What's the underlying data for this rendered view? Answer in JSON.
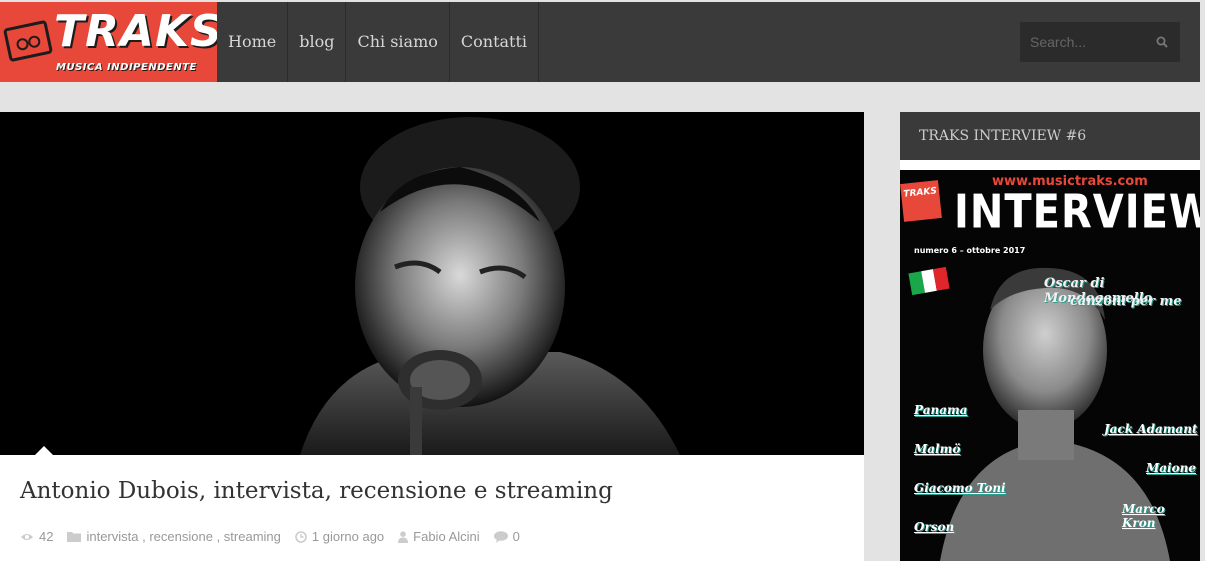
{
  "brand": {
    "name": "TRAKS",
    "tagline": "MUSICA INDIPENDENTE",
    "color": "#e8483a"
  },
  "nav": {
    "items": [
      {
        "label": "Home"
      },
      {
        "label": "blog"
      },
      {
        "label": "Chi siamo"
      },
      {
        "label": "Contatti"
      }
    ]
  },
  "search": {
    "placeholder": "Search..."
  },
  "post": {
    "title": "Antonio Dubois, intervista, recensione e streaming",
    "views": "42",
    "tags": [
      "intervista",
      "recensione",
      "streaming"
    ],
    "tag_sep": " , ",
    "date": "1 giorno ago",
    "author": "Fabio Alcini",
    "comments": "0"
  },
  "sidebar": {
    "widget_title": "TRAKS INTERVIEW #6",
    "magazine": {
      "url": "www.musictraks.com",
      "logo": "TRAKS",
      "headline": "INTERVIEW",
      "issue": "numero 6 – ottobre 2017",
      "feature_name": "Oscar di Mondogemello",
      "feature_sub": "canzoni per me",
      "names": [
        "Panama",
        "Jack Adamant",
        "Malmö",
        "Maione",
        "Giacomo Toni",
        "Marco Kron",
        "Orson"
      ]
    }
  }
}
